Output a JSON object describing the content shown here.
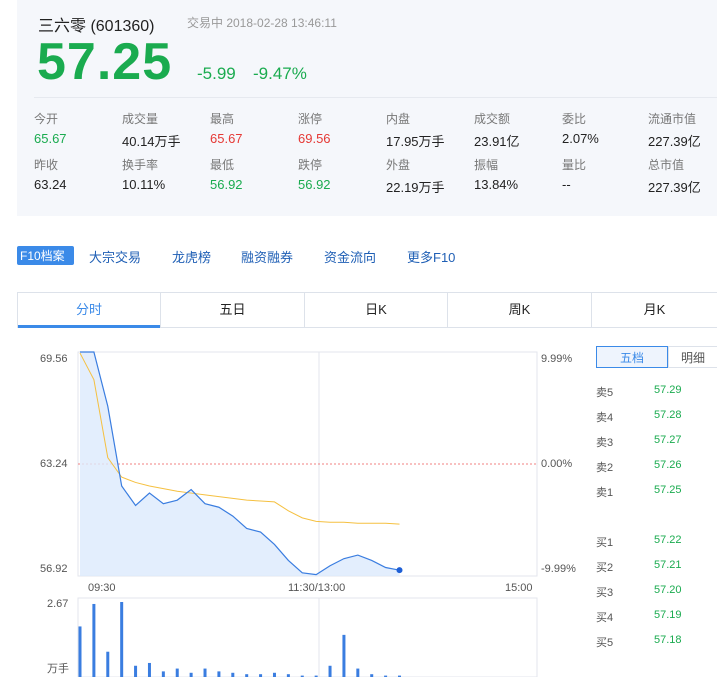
{
  "header": {
    "name_code": "三六零 (601360)",
    "status_time": "交易中 2018-02-28 13:46:11",
    "price": "57.25",
    "change": "-5.99",
    "change_pct": "-9.47%"
  },
  "stats": [
    {
      "label": "今开",
      "value": "65.67",
      "color": "green"
    },
    {
      "label": "成交量",
      "value": "40.14万手",
      "color": "plain"
    },
    {
      "label": "最高",
      "value": "65.67",
      "color": "red"
    },
    {
      "label": "涨停",
      "value": "69.56",
      "color": "red"
    },
    {
      "label": "内盘",
      "value": "17.95万手",
      "color": "plain"
    },
    {
      "label": "成交额",
      "value": "23.91亿",
      "color": "plain"
    },
    {
      "label": "委比",
      "value": "2.07%",
      "color": "plain"
    },
    {
      "label": "流通市值",
      "value": "227.39亿",
      "color": "plain"
    },
    {
      "label": "昨收",
      "value": "63.24",
      "color": "plain"
    },
    {
      "label": "换手率",
      "value": "10.11%",
      "color": "plain"
    },
    {
      "label": "最低",
      "value": "56.92",
      "color": "green"
    },
    {
      "label": "跌停",
      "value": "56.92",
      "color": "green"
    },
    {
      "label": "外盘",
      "value": "22.19万手",
      "color": "plain"
    },
    {
      "label": "振幅",
      "value": "13.84%",
      "color": "plain"
    },
    {
      "label": "量比",
      "value": "--",
      "color": "plain"
    },
    {
      "label": "总市值",
      "value": "227.39亿",
      "color": "plain"
    }
  ],
  "f10": {
    "badge": "F10档案",
    "links": [
      "大宗交易",
      "龙虎榜",
      "融资融券",
      "资金流向",
      "更多F10"
    ]
  },
  "tabs": [
    "分时",
    "五日",
    "日K",
    "周K",
    "月K"
  ],
  "active_tab": "分时",
  "chart": {
    "y_labels": [
      "69.56",
      "63.24",
      "56.92"
    ],
    "pct_labels": [
      "9.99%",
      "0.00%",
      "-9.99%"
    ],
    "x_labels": [
      "09:30",
      "11:30/13:00",
      "15:00"
    ],
    "vol_labels": [
      "2.67",
      "万手"
    ]
  },
  "chart_data": {
    "type": "line",
    "title": "",
    "ylim": [
      56.92,
      69.56
    ],
    "prev_close": 63.24,
    "x": [
      "09:30",
      "09:35",
      "09:40",
      "09:45",
      "09:50",
      "09:55",
      "10:00",
      "10:05",
      "10:10",
      "10:15",
      "10:20",
      "10:30",
      "10:40",
      "10:50",
      "11:00",
      "11:10",
      "11:20",
      "11:30",
      "13:00",
      "13:10",
      "13:20",
      "13:30",
      "13:40",
      "13:46"
    ],
    "series": [
      {
        "values": [
          69.56,
          69.56,
          66.5,
          62.0,
          60.9,
          61.6,
          61.0,
          61.2,
          61.8,
          61.0,
          60.8,
          60.3,
          59.6,
          59.4,
          58.7,
          57.8,
          57.1,
          57.0,
          57.5,
          57.9,
          58.1,
          57.8,
          57.4,
          57.25
        ]
      },
      {
        "values": [
          69.5,
          68.0,
          63.6,
          62.5,
          62.2,
          62.0,
          61.85,
          61.7,
          61.6,
          61.5,
          61.4,
          61.3,
          61.2,
          61.15,
          61.1,
          60.6,
          60.2,
          60.0,
          59.95,
          59.95,
          59.9,
          59.9,
          59.9,
          59.85
        ]
      }
    ],
    "volume": {
      "max": 2.67,
      "unit": "万手",
      "values": [
        1.8,
        2.6,
        0.9,
        2.67,
        0.4,
        0.5,
        0.2,
        0.3,
        0.15,
        0.3,
        0.2,
        0.15,
        0.1,
        0.1,
        0.15,
        0.1,
        0.05,
        0.05,
        0.4,
        1.5,
        0.3,
        0.1,
        0.05,
        0.05
      ]
    }
  },
  "book": {
    "tabs": [
      "五档",
      "明细"
    ],
    "sells": [
      {
        "label": "卖5",
        "price": "57.29"
      },
      {
        "label": "卖4",
        "price": "57.28"
      },
      {
        "label": "卖3",
        "price": "57.27"
      },
      {
        "label": "卖2",
        "price": "57.26"
      },
      {
        "label": "卖1",
        "price": "57.25"
      }
    ],
    "buys": [
      {
        "label": "买1",
        "price": "57.22"
      },
      {
        "label": "买2",
        "price": "57.21"
      },
      {
        "label": "买3",
        "price": "57.20"
      },
      {
        "label": "买4",
        "price": "57.19"
      },
      {
        "label": "买5",
        "price": "57.18"
      }
    ]
  },
  "colors": {
    "down": "#1aab4f",
    "up": "#e53935",
    "accent": "#3b8ae8",
    "price_line": "#3a7de0",
    "avg_line": "#f5c040"
  }
}
